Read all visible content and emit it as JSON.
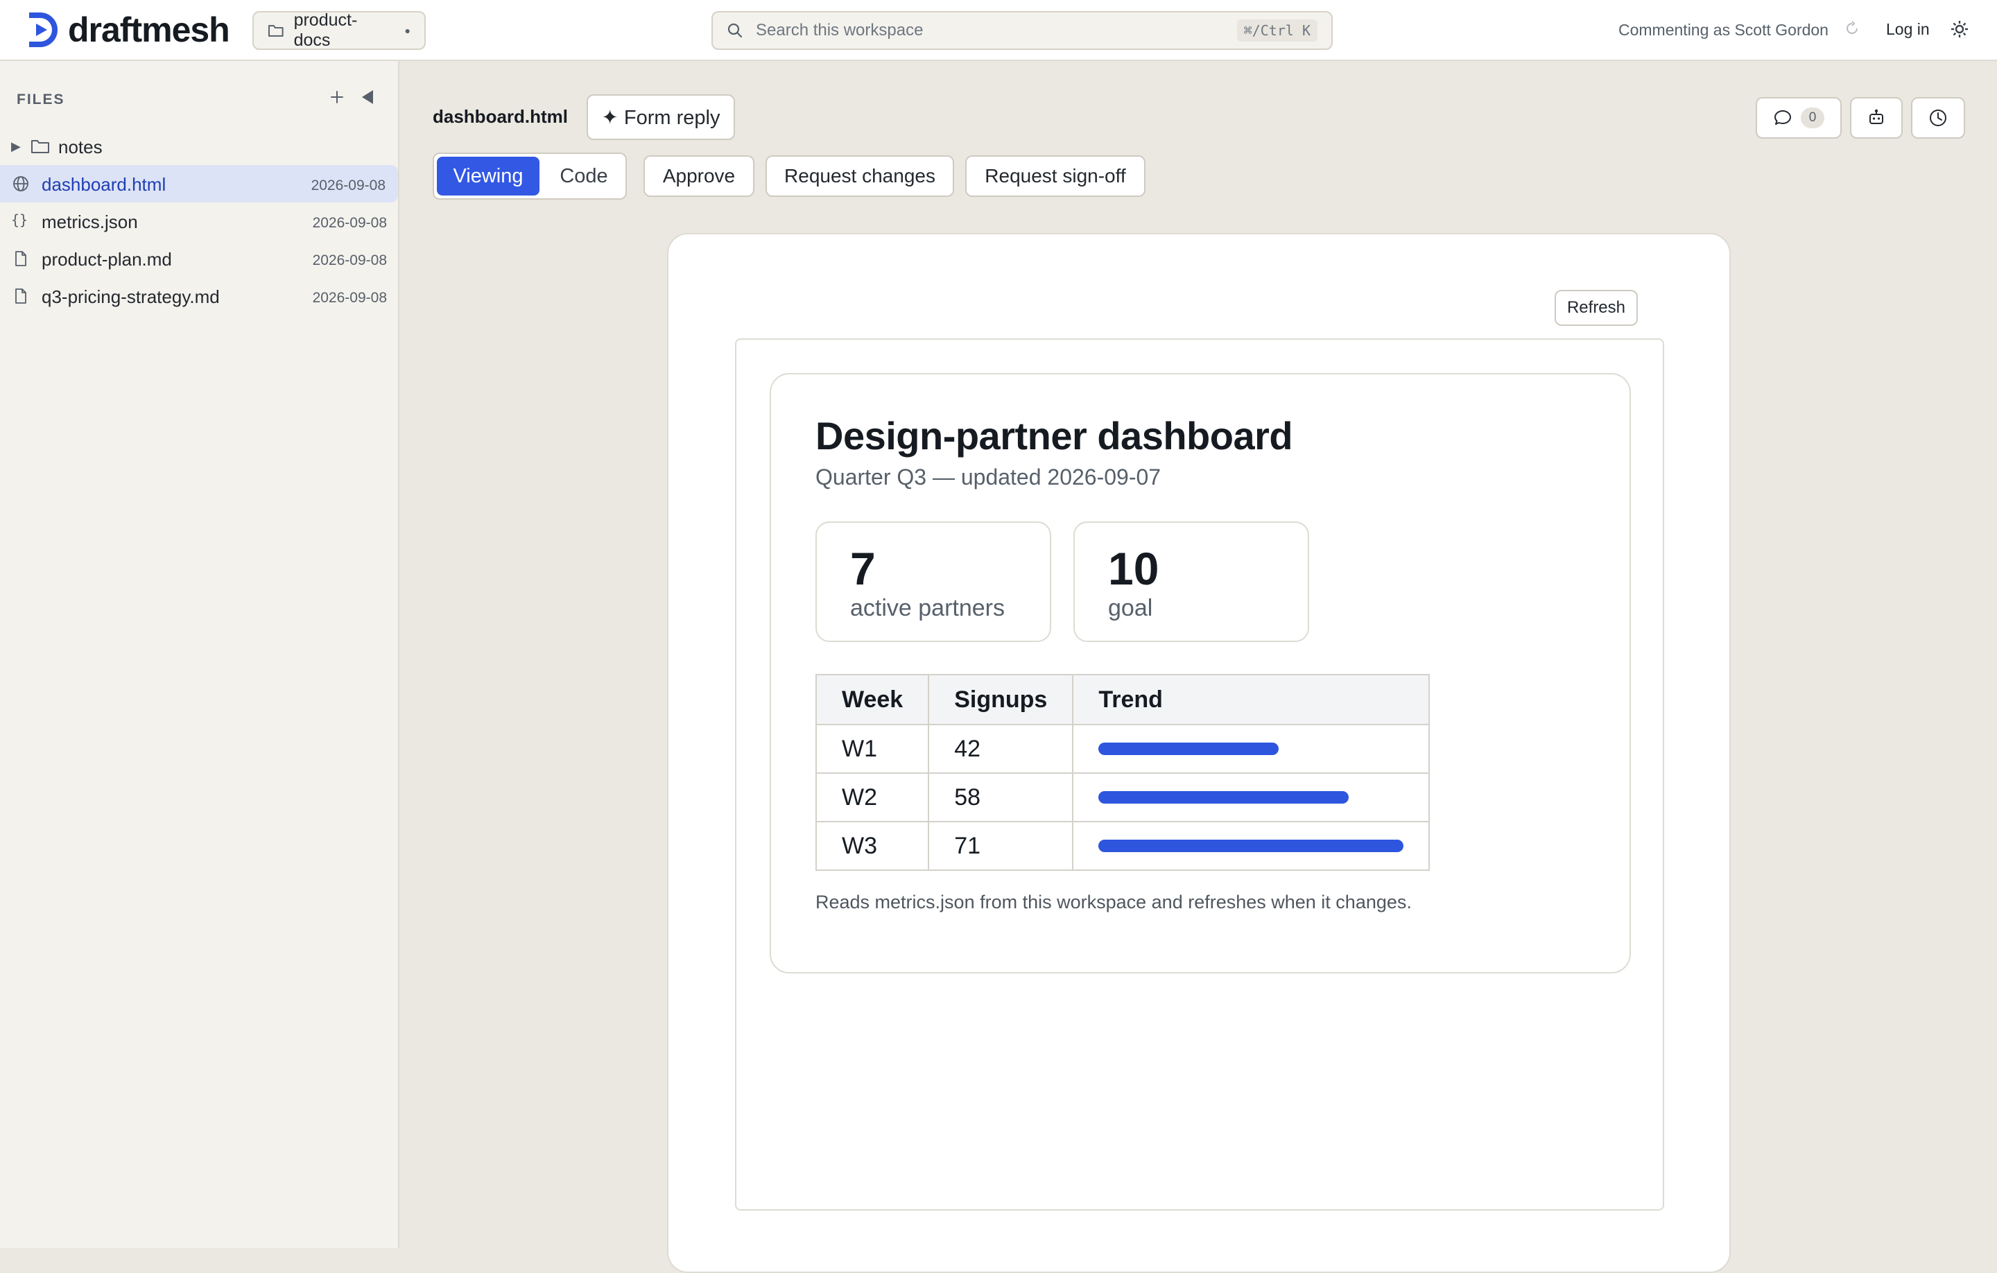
{
  "app": {
    "name": "draftmesh",
    "workspace": "product-docs",
    "search": {
      "placeholder": "Search this workspace",
      "shortcut": "⌘/Ctrl K"
    },
    "commenting_as": "Commenting as Scott Gordon",
    "login_label": "Log in",
    "accent_color": "#3358e4"
  },
  "sidebar": {
    "heading": "FILES",
    "folders": [
      {
        "name": "notes",
        "icon": "folder-icon",
        "expanded": false
      }
    ],
    "files": [
      {
        "name": "dashboard.html",
        "date": "2026-09-08",
        "icon": "globe-icon",
        "active": true
      },
      {
        "name": "metrics.json",
        "date": "2026-09-08",
        "icon": "braces-icon",
        "active": false
      },
      {
        "name": "product-plan.md",
        "date": "2026-09-08",
        "icon": "file-icon",
        "active": false
      },
      {
        "name": "q3-pricing-strategy.md",
        "date": "2026-09-08",
        "icon": "file-icon",
        "active": false
      }
    ]
  },
  "toolbar": {
    "doc_title": "dashboard.html",
    "form_reply_label": "✦ Form reply",
    "view_modes": [
      "Viewing",
      "Code"
    ],
    "active_view_mode": "Viewing",
    "approve_label": "Approve",
    "request_changes_label": "Request changes",
    "request_signoff_label": "Request sign-off",
    "comment_count": "0"
  },
  "preview": {
    "refresh_label": "Refresh",
    "title": "Design-partner dashboard",
    "subtitle": "Quarter Q3 — updated 2026-09-07",
    "stats": [
      {
        "value": "7",
        "label": "active partners"
      },
      {
        "value": "10",
        "label": "goal"
      }
    ],
    "table": {
      "headers": [
        "Week",
        "Signups",
        "Trend"
      ],
      "rows": [
        {
          "week": "W1",
          "signups": "42",
          "trend_fraction": 0.59
        },
        {
          "week": "W2",
          "signups": "58",
          "trend_fraction": 0.82
        },
        {
          "week": "W3",
          "signups": "71",
          "trend_fraction": 1.0
        }
      ],
      "bar_color": "#2d55de"
    },
    "note": "Reads metrics.json from this workspace and refreshes when it changes."
  }
}
